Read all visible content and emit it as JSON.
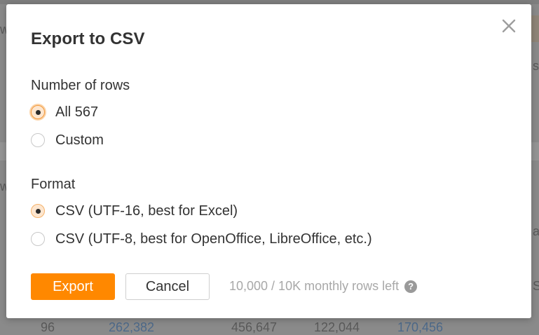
{
  "dialog": {
    "title": "Export to CSV",
    "close_icon": "close-icon",
    "rows_section": {
      "label": "Number of rows",
      "options": [
        {
          "label": "All 567",
          "selected": true
        },
        {
          "label": "Custom",
          "selected": false
        }
      ]
    },
    "format_section": {
      "label": "Format",
      "options": [
        {
          "label": "CSV (UTF-16, best for Excel)",
          "selected": true
        },
        {
          "label": "CSV (UTF-8, best for OpenOffice, LibreOffice, etc.)",
          "selected": false
        }
      ]
    },
    "actions": {
      "export_label": "Export",
      "cancel_label": "Cancel"
    },
    "quota_text": "10,000 / 10K monthly rows left",
    "help_icon": "question-circle-icon",
    "help_glyph": "?"
  },
  "background": {
    "fragments": [
      "w",
      "s",
      "w",
      "ar",
      "S",
      "96",
      "262,382",
      "456,647",
      "122,044",
      "170,456"
    ]
  },
  "colors": {
    "accent": "#ff8800",
    "overlay": "#8a8a8a"
  }
}
